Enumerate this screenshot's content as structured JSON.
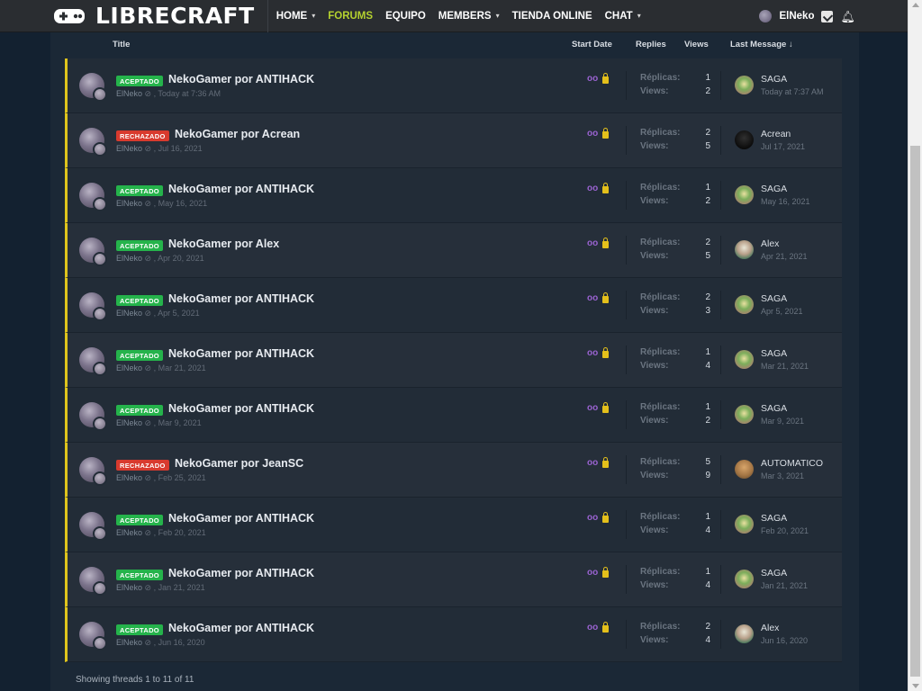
{
  "header": {
    "logo_text": "LIBRECRAFT",
    "nav": [
      {
        "label": "HOME",
        "dropdown": true,
        "active": false
      },
      {
        "label": "FORUMS",
        "dropdown": false,
        "active": true
      },
      {
        "label": "EQUIPO",
        "dropdown": false,
        "active": false
      },
      {
        "label": "MEMBERS",
        "dropdown": true,
        "active": false
      },
      {
        "label": "TIENDA ONLINE",
        "dropdown": false,
        "active": false
      },
      {
        "label": "CHAT",
        "dropdown": true,
        "active": false
      }
    ],
    "user": {
      "name": "ElNeko"
    }
  },
  "columns": {
    "title": "Title",
    "start_date": "Start Date",
    "replies": "Replies",
    "views": "Views",
    "last_message": "Last Message ↓"
  },
  "stat_labels": {
    "replies": "Réplicas:",
    "views": "Views:"
  },
  "threads": [
    {
      "badge": "ACEPTADO",
      "status": "ok",
      "title": "NekoGamer por ANTIHACK",
      "author": "ElNeko",
      "date": "Today at 7:36 AM",
      "replies": "1",
      "views": "2",
      "last_user": "SAGA",
      "last_date": "Today at 7:37 AM",
      "avatar": "saga"
    },
    {
      "badge": "RECHAZADO",
      "status": "no",
      "title": "NekoGamer por Acrean",
      "author": "ElNeko",
      "date": "Jul 16, 2021",
      "replies": "2",
      "views": "5",
      "last_user": "Acrean",
      "last_date": "Jul 17, 2021",
      "avatar": "acrean"
    },
    {
      "badge": "ACEPTADO",
      "status": "ok",
      "title": "NekoGamer por ANTIHACK",
      "author": "ElNeko",
      "date": "May 16, 2021",
      "replies": "1",
      "views": "2",
      "last_user": "SAGA",
      "last_date": "May 16, 2021",
      "avatar": "saga"
    },
    {
      "badge": "ACEPTADO",
      "status": "ok",
      "title": "NekoGamer por Alex",
      "author": "ElNeko",
      "date": "Apr 20, 2021",
      "replies": "2",
      "views": "5",
      "last_user": "Alex",
      "last_date": "Apr 21, 2021",
      "avatar": "alex"
    },
    {
      "badge": "ACEPTADO",
      "status": "ok",
      "title": "NekoGamer por ANTIHACK",
      "author": "ElNeko",
      "date": "Apr 5, 2021",
      "replies": "2",
      "views": "3",
      "last_user": "SAGA",
      "last_date": "Apr 5, 2021",
      "avatar": "saga"
    },
    {
      "badge": "ACEPTADO",
      "status": "ok",
      "title": "NekoGamer por ANTIHACK",
      "author": "ElNeko",
      "date": "Mar 21, 2021",
      "replies": "1",
      "views": "4",
      "last_user": "SAGA",
      "last_date": "Mar 21, 2021",
      "avatar": "saga"
    },
    {
      "badge": "ACEPTADO",
      "status": "ok",
      "title": "NekoGamer por ANTIHACK",
      "author": "ElNeko",
      "date": "Mar 9, 2021",
      "replies": "1",
      "views": "2",
      "last_user": "SAGA",
      "last_date": "Mar 9, 2021",
      "avatar": "saga"
    },
    {
      "badge": "RECHAZADO",
      "status": "no",
      "title": "NekoGamer por JeanSC",
      "author": "ElNeko",
      "date": "Feb 25, 2021",
      "replies": "5",
      "views": "9",
      "last_user": "AUTOMATICO",
      "last_date": "Mar 3, 2021",
      "avatar": "auto"
    },
    {
      "badge": "ACEPTADO",
      "status": "ok",
      "title": "NekoGamer por ANTIHACK",
      "author": "ElNeko",
      "date": "Feb 20, 2021",
      "replies": "1",
      "views": "4",
      "last_user": "SAGA",
      "last_date": "Feb 20, 2021",
      "avatar": "saga"
    },
    {
      "badge": "ACEPTADO",
      "status": "ok",
      "title": "NekoGamer por ANTIHACK",
      "author": "ElNeko",
      "date": "Jan 21, 2021",
      "replies": "1",
      "views": "4",
      "last_user": "SAGA",
      "last_date": "Jan 21, 2021",
      "avatar": "saga"
    },
    {
      "badge": "ACEPTADO",
      "status": "ok",
      "title": "NekoGamer por ANTIHACK",
      "author": "ElNeko",
      "date": "Jun 16, 2020",
      "replies": "2",
      "views": "4",
      "last_user": "Alex",
      "last_date": "Jun 16, 2020",
      "avatar": "alex"
    }
  ],
  "footer": {
    "text": "Showing threads 1 to 11 of 11"
  },
  "colors": {
    "accent": "#b5d22f",
    "accepted": "#25b34b",
    "rejected": "#d83a2e",
    "sticky_border": "#dfc41c",
    "watch_icon": "#9a63d1",
    "lock_icon": "#e4c01b"
  }
}
